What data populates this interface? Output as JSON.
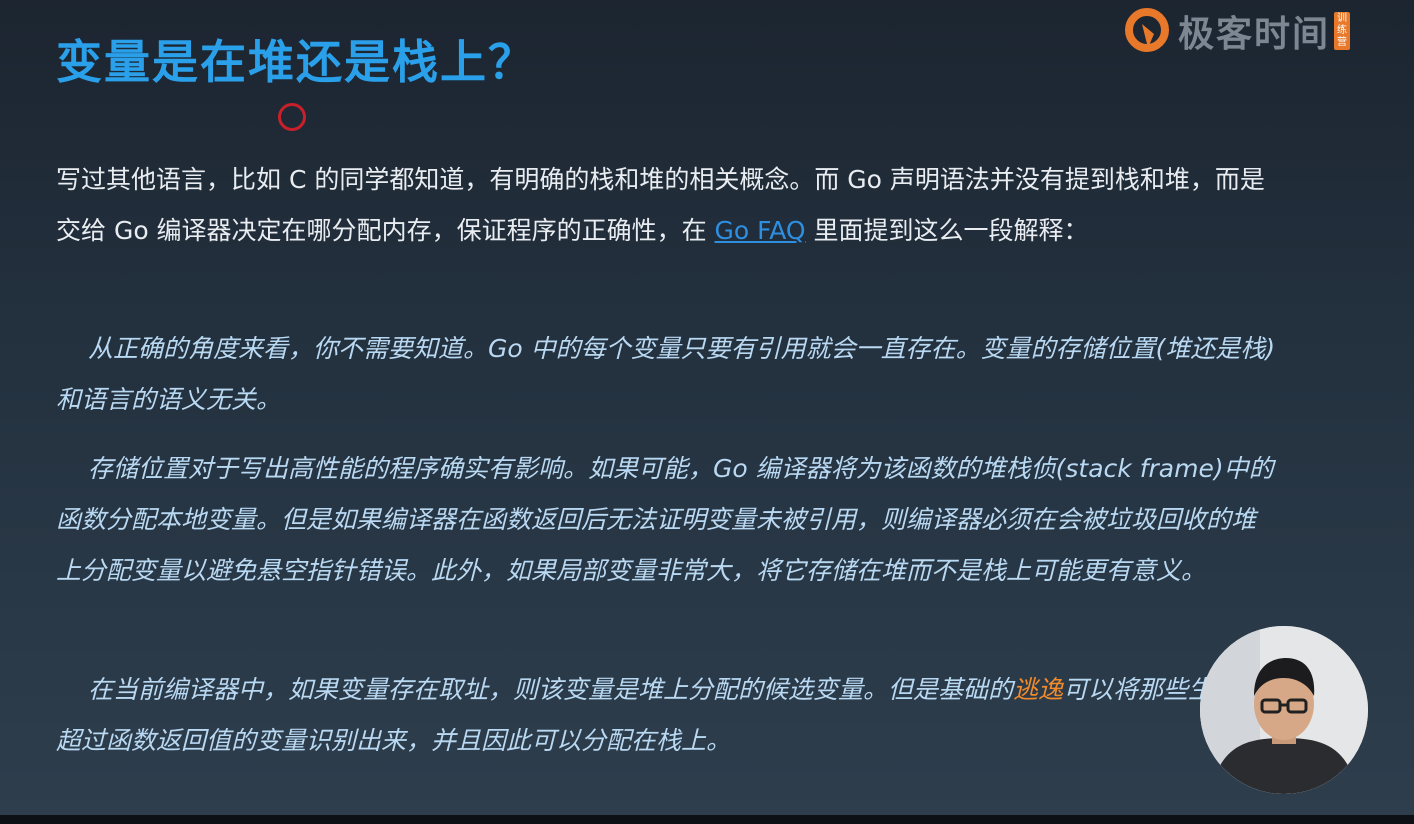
{
  "title": "变量是在堆还是栈上？",
  "brand": {
    "name": "极客时间",
    "tag": "训练营",
    "icon": "geektime-logo-icon",
    "accent": "#e8782a"
  },
  "intro": {
    "before_link": "写过其他语言，比如 C 的同学都知道，有明确的栈和堆的相关概念。而 Go 声明语法并没有提到栈和堆，而是交给 Go 编译器决定在哪分配内存，保证程序的正确性，在 ",
    "link_text": "Go FAQ",
    "after_link": " 里面提到这么一段解释："
  },
  "quotes": [
    {
      "text": "从正确的角度来看，你不需要知道。Go 中的每个变量只要有引用就会一直存在。变量的存储位置(堆还是栈)和语言的语义无关。"
    },
    {
      "text": "存储位置对于写出高性能的程序确实有影响。如果可能，Go 编译器将为该函数的堆栈侦(stack frame)中的函数分配本地变量。但是如果编译器在函数返回后无法证明变量未被引用，则编译器必须在会被垃圾回收的堆上分配变量以避免悬空指针错误。此外，如果局部变量非常大，将它存储在堆而不是栈上可能更有意义。"
    },
    {
      "before": "在当前编译器中，如果变量存在取址，则该变量是堆上分配的候选变量。但是基础的",
      "highlight": "逃逸",
      "after": "可以将那些生存不超过函数返回值的变量识别出来，并且因此可以分配在栈上。"
    }
  ],
  "colors": {
    "title": "#2aa0ea",
    "body": "#e9edf1",
    "quote": "#b9d8f2",
    "link": "#2e8fe0",
    "highlight": "#f08a2a",
    "pointer": "#c8202a"
  }
}
